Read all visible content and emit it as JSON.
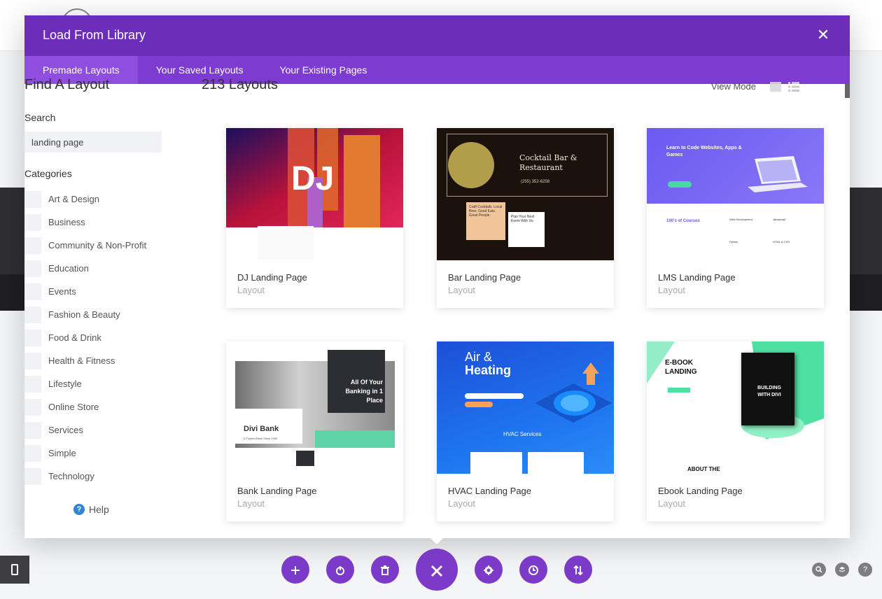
{
  "modal": {
    "title": "Load From Library",
    "close_icon": "close-icon"
  },
  "tabs": [
    {
      "label": "Premade Layouts",
      "active": true
    },
    {
      "label": "Your Saved Layouts",
      "active": false
    },
    {
      "label": "Your Existing Pages",
      "active": false
    }
  ],
  "sidebar": {
    "title": "Find A Layout",
    "search_label": "Search",
    "search_value": "landing page",
    "categories_label": "Categories",
    "categories": [
      "Art & Design",
      "Business",
      "Community & Non-Profit",
      "Education",
      "Events",
      "Fashion & Beauty",
      "Food & Drink",
      "Health & Fitness",
      "Lifestyle",
      "Online Store",
      "Services",
      "Simple",
      "Technology"
    ],
    "help_label": "Help"
  },
  "content": {
    "count_title": "213 Layouts",
    "view_mode_label": "View Mode"
  },
  "layouts": [
    {
      "name": "DJ Landing Page",
      "type": "Layout",
      "thumb": {
        "text": "DJ"
      }
    },
    {
      "name": "Bar Landing Page",
      "type": "Layout",
      "thumb": {
        "heading": "Cocktail Bar & Restaurant",
        "phone": "(255) 352-6258",
        "card1": "Craft Cocktails. Local Beer. Good Eats. Great People.",
        "card2": "Plan Your Next Event With Us"
      }
    },
    {
      "name": "LMS Landing Page",
      "type": "Layout",
      "thumb": {
        "heading": "Learn to Code Websites, Apps & Games",
        "sub": "100's of Courses",
        "f1": "Web Development",
        "f2": "Javascript",
        "f3": "Python",
        "f4": "HTML & CSS"
      }
    },
    {
      "name": "Bank Landing Page",
      "type": "Layout",
      "thumb": {
        "heading": "All Of Your Banking in 1 Place",
        "brand": "Divi Bank",
        "tag": "A Trusted Bank Since 1990"
      }
    },
    {
      "name": "HVAC Landing Page",
      "type": "Layout",
      "thumb": {
        "heading1": "Air &",
        "heading2": "Heating",
        "sub": "HVAC Services"
      }
    },
    {
      "name": "Ebook Landing Page",
      "type": "Layout",
      "thumb": {
        "heading": "E-BOOK LANDING",
        "book": "BUILDING WITH DIVI",
        "about": "ABOUT THE"
      }
    }
  ],
  "toolbar": {
    "buttons": [
      "add-icon",
      "power-icon",
      "trash-icon",
      "close-icon",
      "gear-icon",
      "history-icon",
      "sort-icon"
    ]
  },
  "colors": {
    "primary": "#6c2eb9",
    "tabs": "#7d3bd2",
    "active_tab": "#8f4ee0",
    "help": "#2d86d6"
  }
}
